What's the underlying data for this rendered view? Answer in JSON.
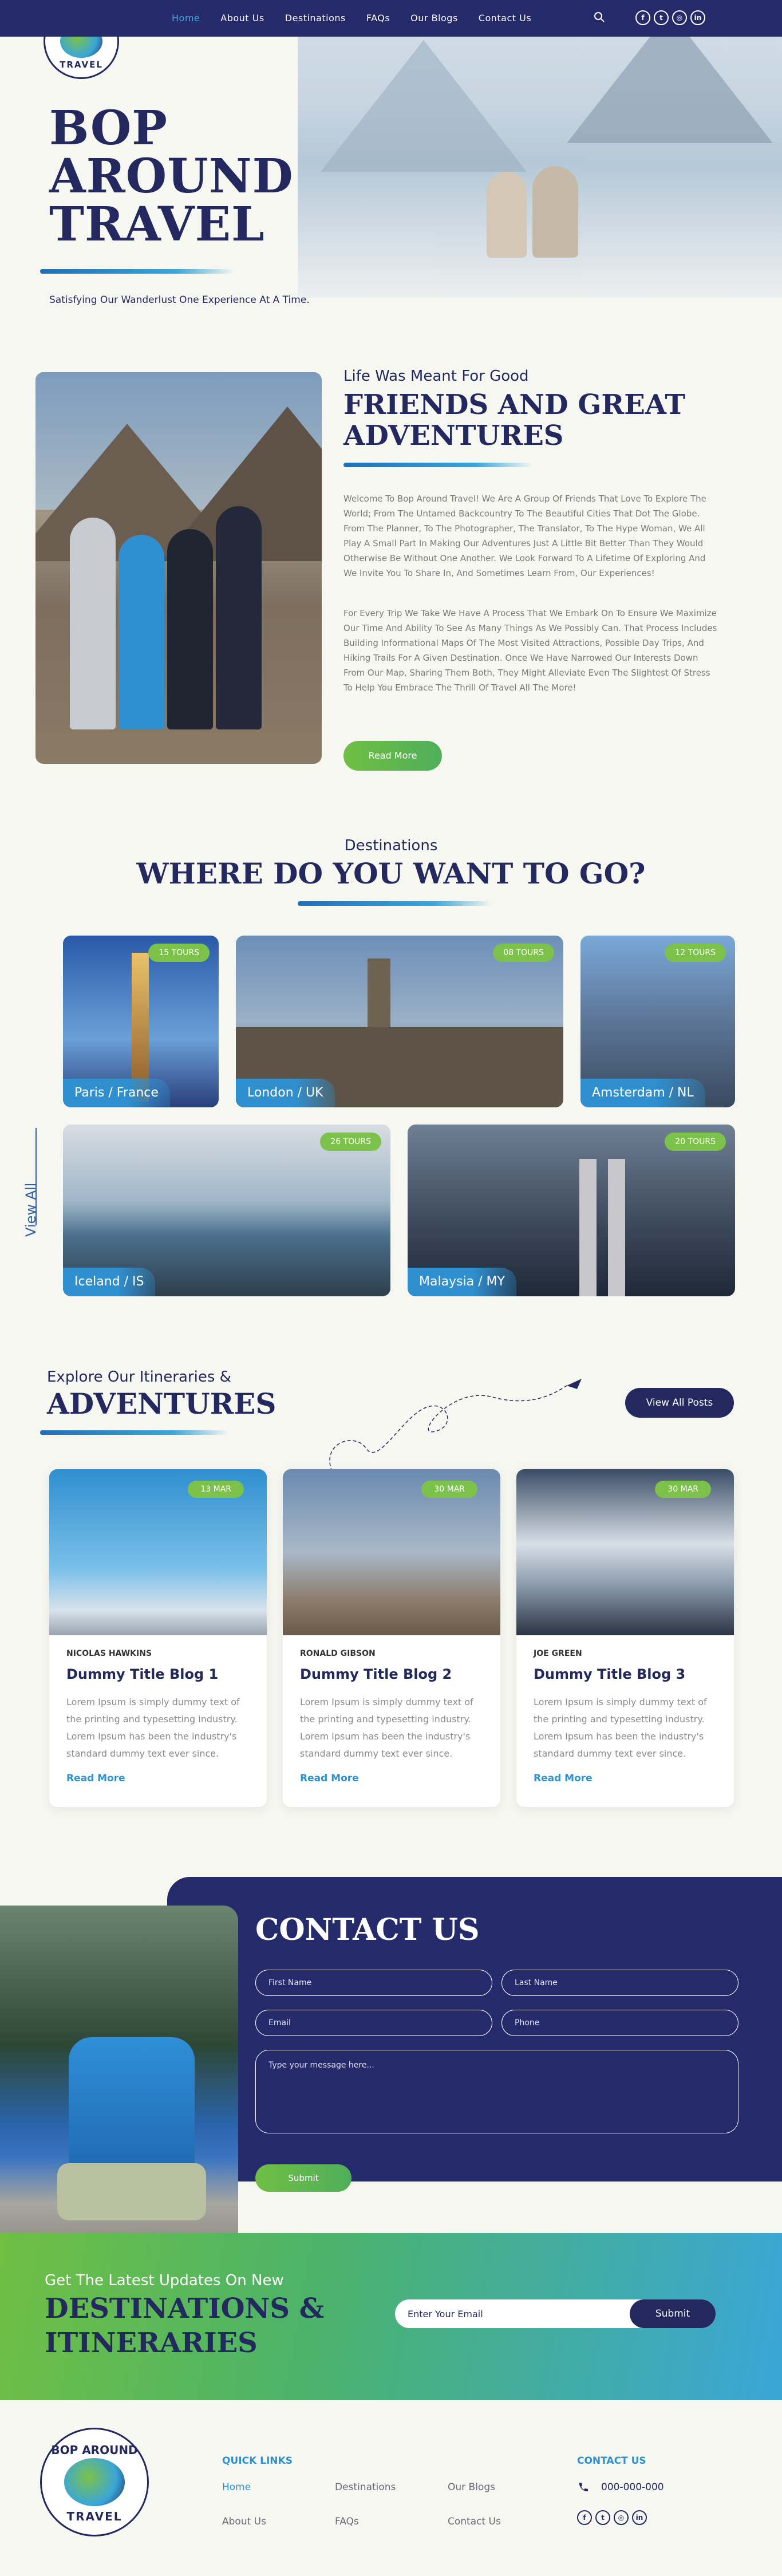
{
  "nav": {
    "items": [
      {
        "label": "Home",
        "active": true
      },
      {
        "label": "About Us"
      },
      {
        "label": "Destinations"
      },
      {
        "label": "FAQs"
      },
      {
        "label": "Our Blogs"
      },
      {
        "label": "Contact Us"
      }
    ],
    "social": [
      "f",
      "t",
      "ig",
      "in"
    ]
  },
  "logo": {
    "line1": "BOP AROUND",
    "line2": "TRAVEL"
  },
  "hero": {
    "title_line1": "BOP",
    "title_line2": "AROUND",
    "title_line3": "TRAVEL",
    "subtitle": "Satisfying Our Wanderlust One Experience At A Time."
  },
  "about": {
    "kicker": "Life Was Meant For Good",
    "title_line1": "FRIENDS AND GREAT",
    "title_line2": "ADVENTURES",
    "para1": "Welcome To Bop Around Travel! We Are A Group Of Friends That Love To Explore The World; From The Untamed Backcountry To The Beautiful Cities That Dot The Globe. From The Planner, To The Photographer, The Translator, To The Hype Woman, We All Play A Small Part In Making Our Adventures Just A Little Bit Better Than They Would Otherwise Be Without One Another. We Look Forward To A Lifetime Of Exploring And We Invite You To Share In, And Sometimes Learn From, Our Experiences!",
    "para2": "For Every Trip We Take We Have A Process That We Embark On To Ensure We Maximize Our Time And Ability To See As Many Things As We Possibly Can. That Process Includes Building Informational Maps Of The Most Visited Attractions, Possible Day Trips, And Hiking Trails For A Given Destination. Once We Have Narrowed Our Interests Down From Our Map, Sharing Them Both, They Might Alleviate Even The Slightest Of Stress To Help You Embrace The Thrill Of Travel All The More!",
    "button": "Read More"
  },
  "destinations": {
    "kicker": "Destinations",
    "title": "WHERE DO YOU WANT TO GO?",
    "view_all": "View All",
    "cards": [
      {
        "name": "Paris / France",
        "tours": "15 TOURS"
      },
      {
        "name": "London / UK",
        "tours": "08 TOURS"
      },
      {
        "name": "Amsterdam / NL",
        "tours": "12 TOURS"
      },
      {
        "name": "Iceland / IS",
        "tours": "26 TOURS"
      },
      {
        "name": "Malaysia / MY",
        "tours": "20 TOURS"
      }
    ]
  },
  "itineraries": {
    "kicker": "Explore Our Itineraries &",
    "title": "ADVENTURES",
    "button": "View All Posts",
    "posts": [
      {
        "date": "13 MAR",
        "author": "NICOLAS HAWKINS",
        "title": "Dummy Title Blog 1",
        "text": "Lorem Ipsum is simply dummy text of the printing and typesetting industry. Lorem Ipsum has been the industry's standard dummy text ever since.",
        "more": "Read More"
      },
      {
        "date": "30 MAR",
        "author": "RONALD GIBSON",
        "title": "Dummy Title Blog 2",
        "text": "Lorem Ipsum is simply dummy text of the printing and typesetting industry. Lorem Ipsum has been the industry's standard dummy text ever since.",
        "more": "Read More"
      },
      {
        "date": "30 MAR",
        "author": "JOE GREEN",
        "title": "Dummy Title Blog 3",
        "text": "Lorem Ipsum is simply dummy text of the printing and typesetting industry. Lorem Ipsum has been the industry's standard dummy text ever since.",
        "more": "Read More"
      }
    ]
  },
  "contact": {
    "title": "CONTACT US",
    "first_name": "First Name",
    "last_name": "Last Name",
    "email": "Email",
    "phone": "Phone",
    "message": "Type your message here...",
    "submit": "Submit"
  },
  "newsletter": {
    "kicker": "Get The Latest Updates On New",
    "title_line1": "DESTINATIONS &",
    "title_line2": "ITINERARIES",
    "placeholder": "Enter Your Email",
    "button": "Submit"
  },
  "footer": {
    "quick_links_heading": "QUICK LINKS",
    "links": [
      "Home",
      "Destinations",
      "Our Blogs",
      "About Us",
      "FAQs",
      "Contact Us"
    ],
    "contact_heading": "CONTACT US",
    "phone": "000-000-000"
  },
  "colors": {
    "navy": "#242a6a",
    "accent_blue": "#3aa6d8",
    "accent_green": "#7cc24a"
  }
}
